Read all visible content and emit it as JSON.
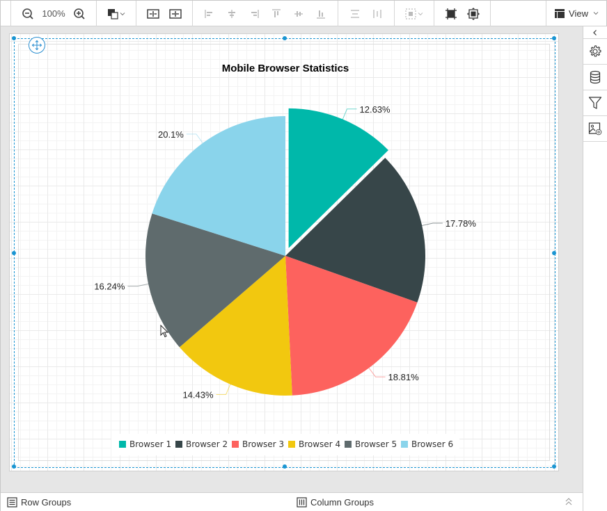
{
  "toolbar": {
    "zoom_level": "100%",
    "view_label": "View",
    "icons": [
      "zoom-out-icon",
      "zoom-in-icon",
      "fill-color-icon",
      "chevron-down-icon",
      "fit-width-icon",
      "fit-height-icon",
      "align-left-icon",
      "align-center-icon",
      "align-right-icon",
      "align-top-icon",
      "align-middle-icon",
      "align-bottom-icon",
      "distribute-horizontal-icon",
      "distribute-vertical-icon",
      "group-icon",
      "size-to-grid-icon",
      "size-to-content-icon",
      "view-layout-icon"
    ]
  },
  "right_panel": {
    "icons": [
      "collapse-panel-icon",
      "properties-gear-icon",
      "data-source-icon",
      "filter-icon",
      "image-settings-icon"
    ]
  },
  "bottom_bar": {
    "row_groups_label": "Row Groups",
    "column_groups_label": "Column Groups"
  },
  "colors": {
    "selection": "#1a95d2",
    "Browser 1": "#00b8aa",
    "Browser 2": "#374649",
    "Browser 3": "#fd625e",
    "Browser 4": "#f2c80f",
    "Browser 5": "#5f6b6d",
    "Browser 6": "#8ad4eb"
  },
  "chart_data": {
    "type": "pie",
    "title": "Mobile Browser Statistics",
    "categories": [
      "Browser 1",
      "Browser 2",
      "Browser 3",
      "Browser 4",
      "Browser 5",
      "Browser 6"
    ],
    "values": [
      12.63,
      17.78,
      18.81,
      14.43,
      16.24,
      20.1
    ],
    "data_labels": [
      "12.63%",
      "17.78%",
      "18.81%",
      "14.43%",
      "16.24%",
      "20.1%"
    ],
    "colors": [
      "#00b8aa",
      "#374649",
      "#fd625e",
      "#f2c80f",
      "#5f6b6d",
      "#8ad4eb"
    ],
    "exploded_index": 0,
    "start_angle_deg": 0,
    "direction": "clockwise",
    "legend_position": "bottom"
  }
}
